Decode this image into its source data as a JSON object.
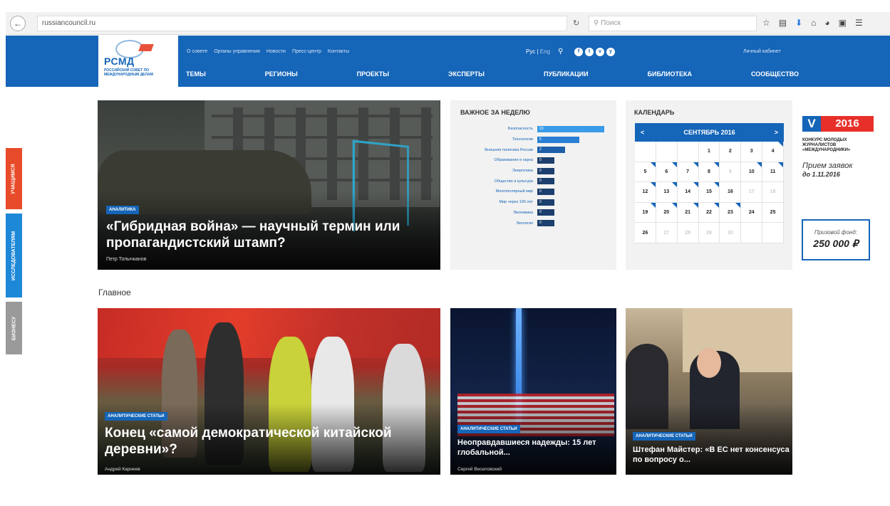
{
  "browser": {
    "url": "russiancouncil.ru",
    "search_placeholder": "Поиск"
  },
  "header": {
    "logo_text": "РСМД",
    "logo_sub": "РОССИЙСКИЙ СОВЕТ ПО МЕЖДУНАРОДНЫМ ДЕЛАМ",
    "top_links": [
      "О совете",
      "Органы управления",
      "Новости",
      "Пресс-центр",
      "Контакты"
    ],
    "lang_ru": "Рус",
    "lang_sep": "|",
    "lang_en": "Eng",
    "cabinet": "Личный кабинет",
    "nav": [
      "ТЕМЫ",
      "РЕГИОНЫ",
      "ПРОЕКТЫ",
      "ЭКСПЕРТЫ",
      "ПУБЛИКАЦИИ",
      "БИБЛИОТЕКА",
      "СООБЩЕСТВО"
    ],
    "socials": [
      "f",
      "t",
      "v",
      "y"
    ]
  },
  "side_tabs": [
    "УЧАЩИМСЯ",
    "ИССЛЕДОВАТЕЛЯМ",
    "БИЗНЕСУ"
  ],
  "hero": {
    "badge": "АНАЛИТИКА",
    "title": "«Гибридная война» — научный термин или пропагандистский штамп?",
    "author": "Петр Топычканов"
  },
  "week": {
    "title": "ВАЖНОЕ ЗА НЕДЕЛЮ",
    "items": [
      {
        "label": "Безопасность",
        "count": "10",
        "level": 1.0,
        "color": "#3a9be8"
      },
      {
        "label": "Технологии",
        "count": "5",
        "level": 0.5,
        "color": "#2a7fd4"
      },
      {
        "label": "Внешняя политика России",
        "count": "2",
        "level": 0.22,
        "color": "#1d5fa8"
      },
      {
        "label": "Образование и наука",
        "count": "0",
        "level": 0.0,
        "color": "#1d3f6e"
      },
      {
        "label": "Энергетика",
        "count": "0",
        "level": 0.0,
        "color": "#1d3f6e"
      },
      {
        "label": "Общество и культура",
        "count": "0",
        "level": 0.0,
        "color": "#1d3f6e"
      },
      {
        "label": "Многополярный мир",
        "count": "0",
        "level": 0.0,
        "color": "#1d3f6e"
      },
      {
        "label": "Мир через 100 лет",
        "count": "0",
        "level": 0.0,
        "color": "#1d3f6e"
      },
      {
        "label": "Экономика",
        "count": "0",
        "level": 0.0,
        "color": "#1d3f6e"
      },
      {
        "label": "Экология",
        "count": "0",
        "level": 0.0,
        "color": "#1d3f6e"
      }
    ]
  },
  "calendar": {
    "title": "КАЛЕНДАРЬ",
    "month": "СЕНТЯБРЬ 2016",
    "prev": "<",
    "next": ">",
    "days": [
      "",
      "",
      "",
      "1",
      "2",
      "3",
      "4",
      "5",
      "6",
      "7",
      "8",
      "9",
      "10",
      "11",
      "12",
      "13",
      "14",
      "15",
      "16",
      "17",
      "18",
      "19",
      "20",
      "21",
      "22",
      "23",
      "24",
      "25",
      "26",
      "27",
      "28",
      "29",
      "30",
      "",
      ""
    ],
    "muted": [
      "9",
      "17",
      "18",
      "27",
      "28",
      "29",
      "30"
    ],
    "events": [
      "4",
      "5",
      "6",
      "7",
      "8",
      "10",
      "11",
      "12",
      "13",
      "14",
      "15",
      "19",
      "20",
      "21",
      "22",
      "23"
    ]
  },
  "promo": {
    "v": "V",
    "year": "2016",
    "subtitle": "КОНКУРС МОЛОДЫХ ЖУРНАЛИСТОВ «МЕЖДУНАРОДНИКИ»",
    "apply": "Прием заявок",
    "deadline": "до 1.11.2016",
    "prize_label": "Призовой фонд:",
    "prize_value": "250 000 ₽"
  },
  "main_section": "Главное",
  "cards": [
    {
      "badge": "АНАЛИТИЧЕСКИЕ СТАТЬИ",
      "title": "Конец «самой демократической китайской деревни»?",
      "author": "Андрей Карнеев"
    },
    {
      "badge": "АНАЛИТИЧЕСКИЕ СТАТЬИ",
      "title": "Неоправдавшиеся надежды: 15 лет глобальной...",
      "author": "Сергей Веселовский"
    },
    {
      "badge": "АНАЛИТИЧЕСКИЕ СТАТЬИ",
      "title": "Штефан Майстер: «В ЕС нет консенсуса по вопросу о...",
      "author": ""
    }
  ]
}
